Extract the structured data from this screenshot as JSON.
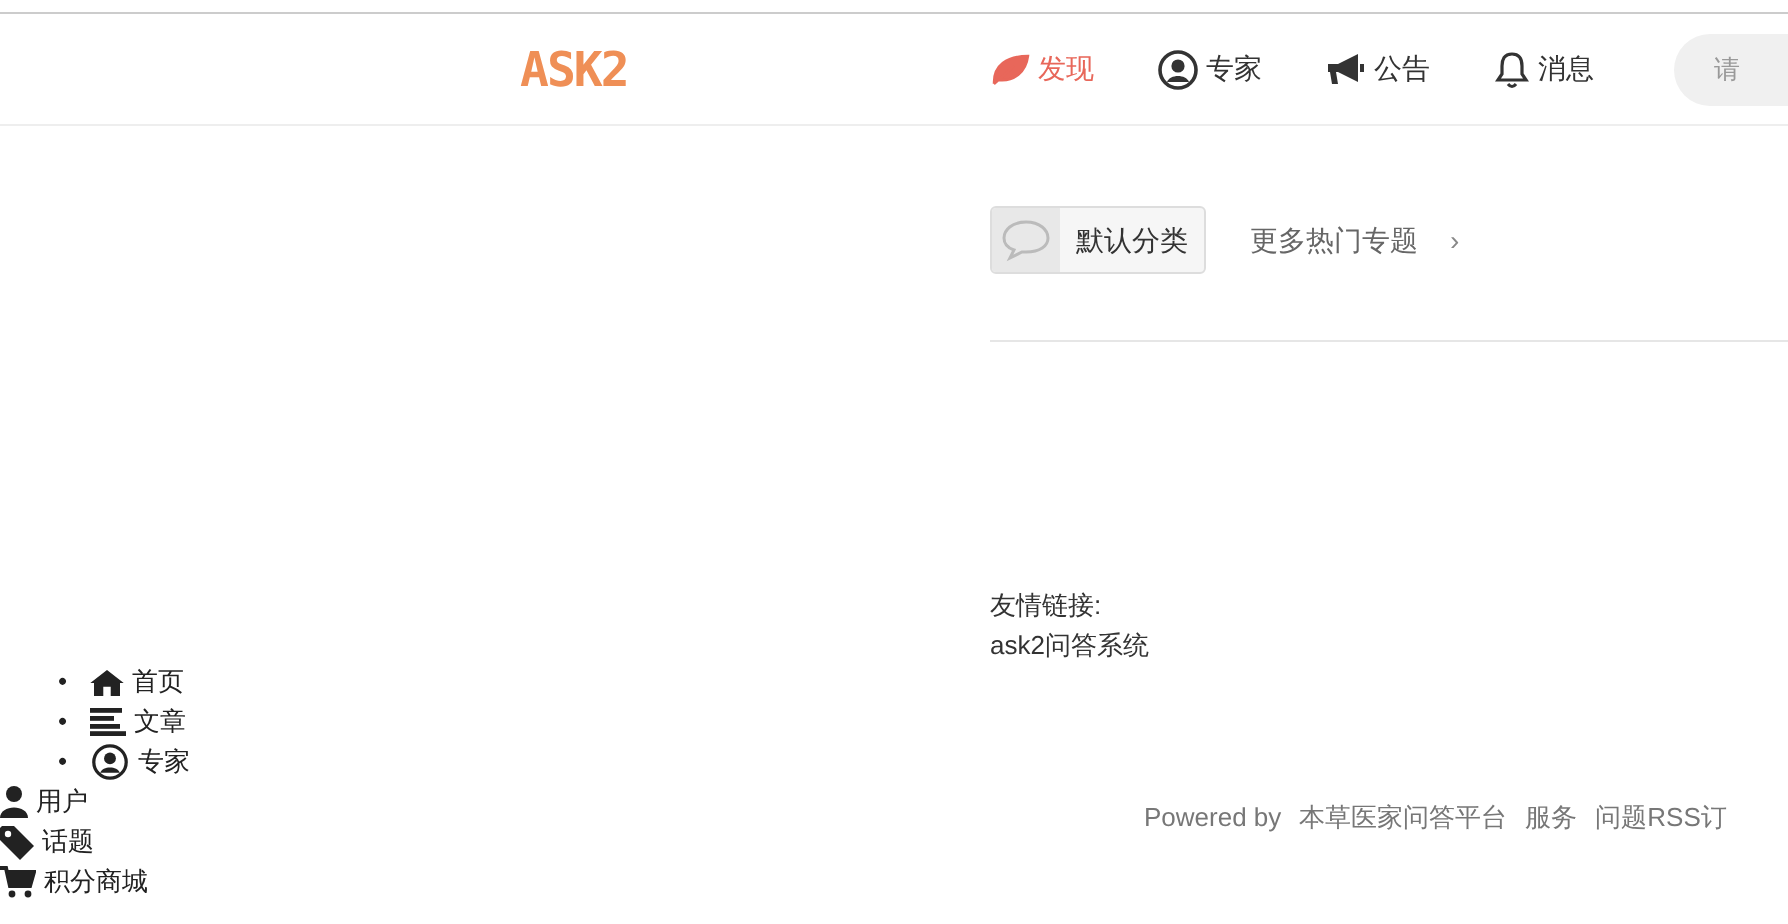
{
  "header": {
    "logo": "ASK2",
    "nav": [
      {
        "label": "发现",
        "kind": "leaf",
        "selected": true
      },
      {
        "label": "专家",
        "kind": "user-circle",
        "selected": false
      },
      {
        "label": "公告",
        "kind": "megaphone",
        "selected": false
      },
      {
        "label": "消息",
        "kind": "bell",
        "selected": false
      }
    ],
    "search": {
      "placeholder": "请"
    }
  },
  "topics": {
    "category": "默认分类",
    "more": "更多热门专题",
    "more_arrow": "›"
  },
  "friend_links": {
    "title": "友情链接:",
    "links": [
      "ask2问答系统"
    ]
  },
  "side_menu": {
    "bulleted": [
      {
        "bullet": "•",
        "label": "首页",
        "kind": "home"
      },
      {
        "bullet": "•",
        "label": "文章",
        "kind": "lines"
      },
      {
        "bullet": "•",
        "label": "专家",
        "kind": "user-circle"
      }
    ],
    "plain": [
      {
        "label": "用户",
        "kind": "user"
      },
      {
        "label": "话题",
        "kind": "tag"
      },
      {
        "label": "积分商城",
        "kind": "cart"
      }
    ]
  },
  "footer": {
    "powered": "Powered by",
    "links": [
      "本草医家问答平台",
      "服务",
      "问题RSS订"
    ]
  }
}
